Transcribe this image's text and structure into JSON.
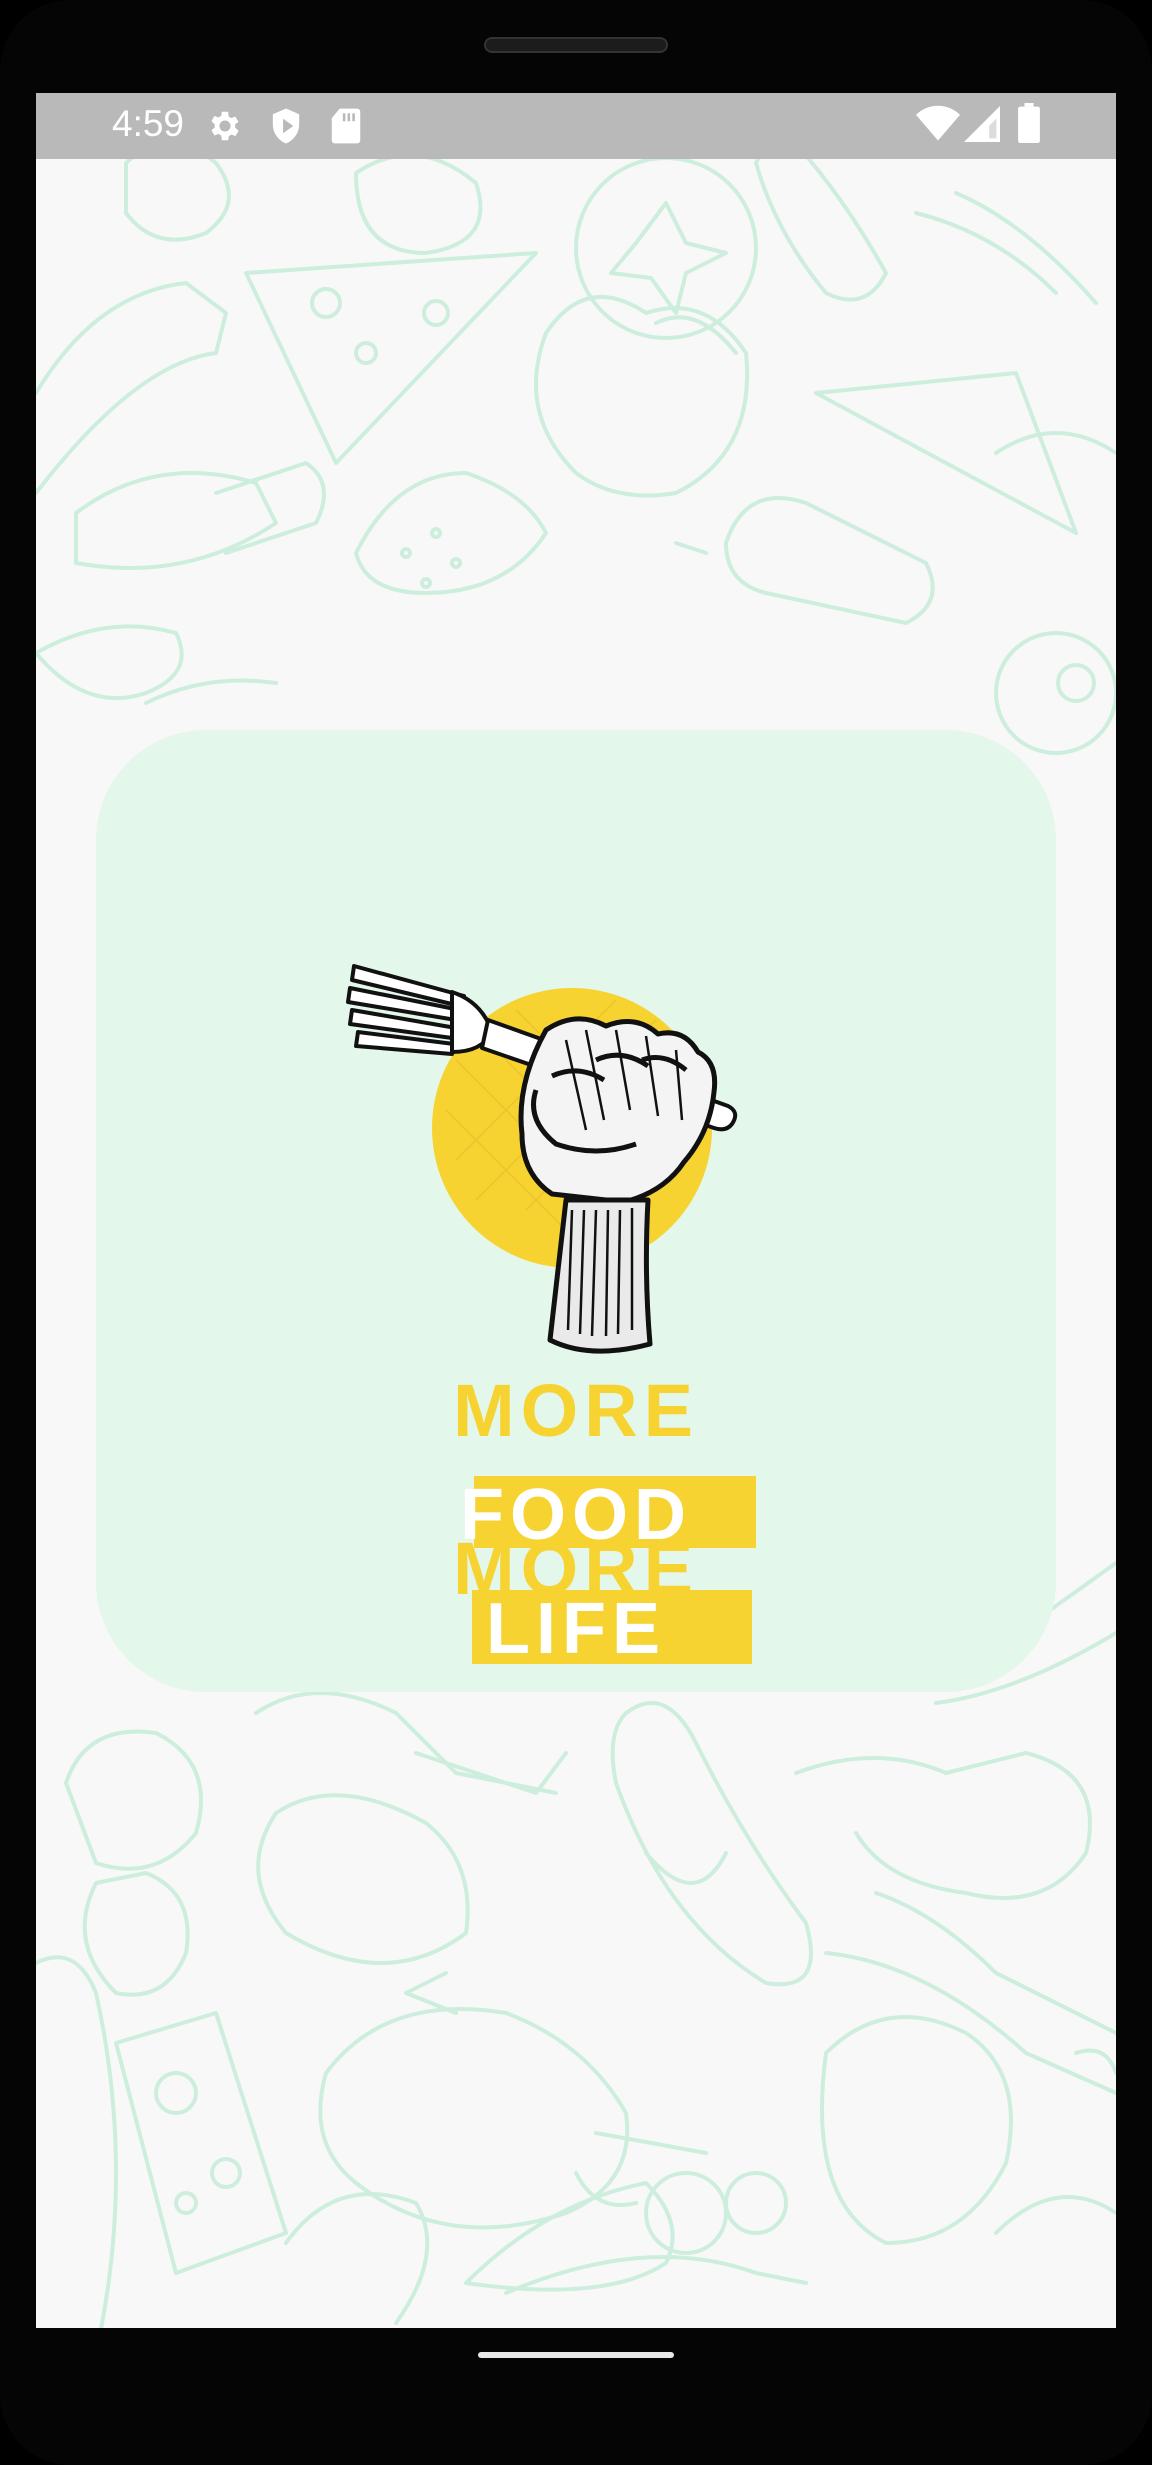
{
  "status_bar": {
    "time": "4:59",
    "left_icons": [
      "settings-icon",
      "play-protect-icon",
      "sd-card-icon"
    ],
    "right_icons": [
      "wifi-icon",
      "cell-signal-icon",
      "battery-icon"
    ]
  },
  "splash": {
    "logo_icon": "fist-holding-fork-icon",
    "slogan": {
      "line1": "MORE",
      "line2": "FOOD",
      "line3": "MORE",
      "line4": "LIFE"
    }
  },
  "colors": {
    "accent_yellow": "#f7d332",
    "card_background": "#e3f7eb",
    "pattern_stroke": "#cdeedd",
    "screen_background": "#f8f8f8",
    "status_bar": "#b9b9b9"
  }
}
